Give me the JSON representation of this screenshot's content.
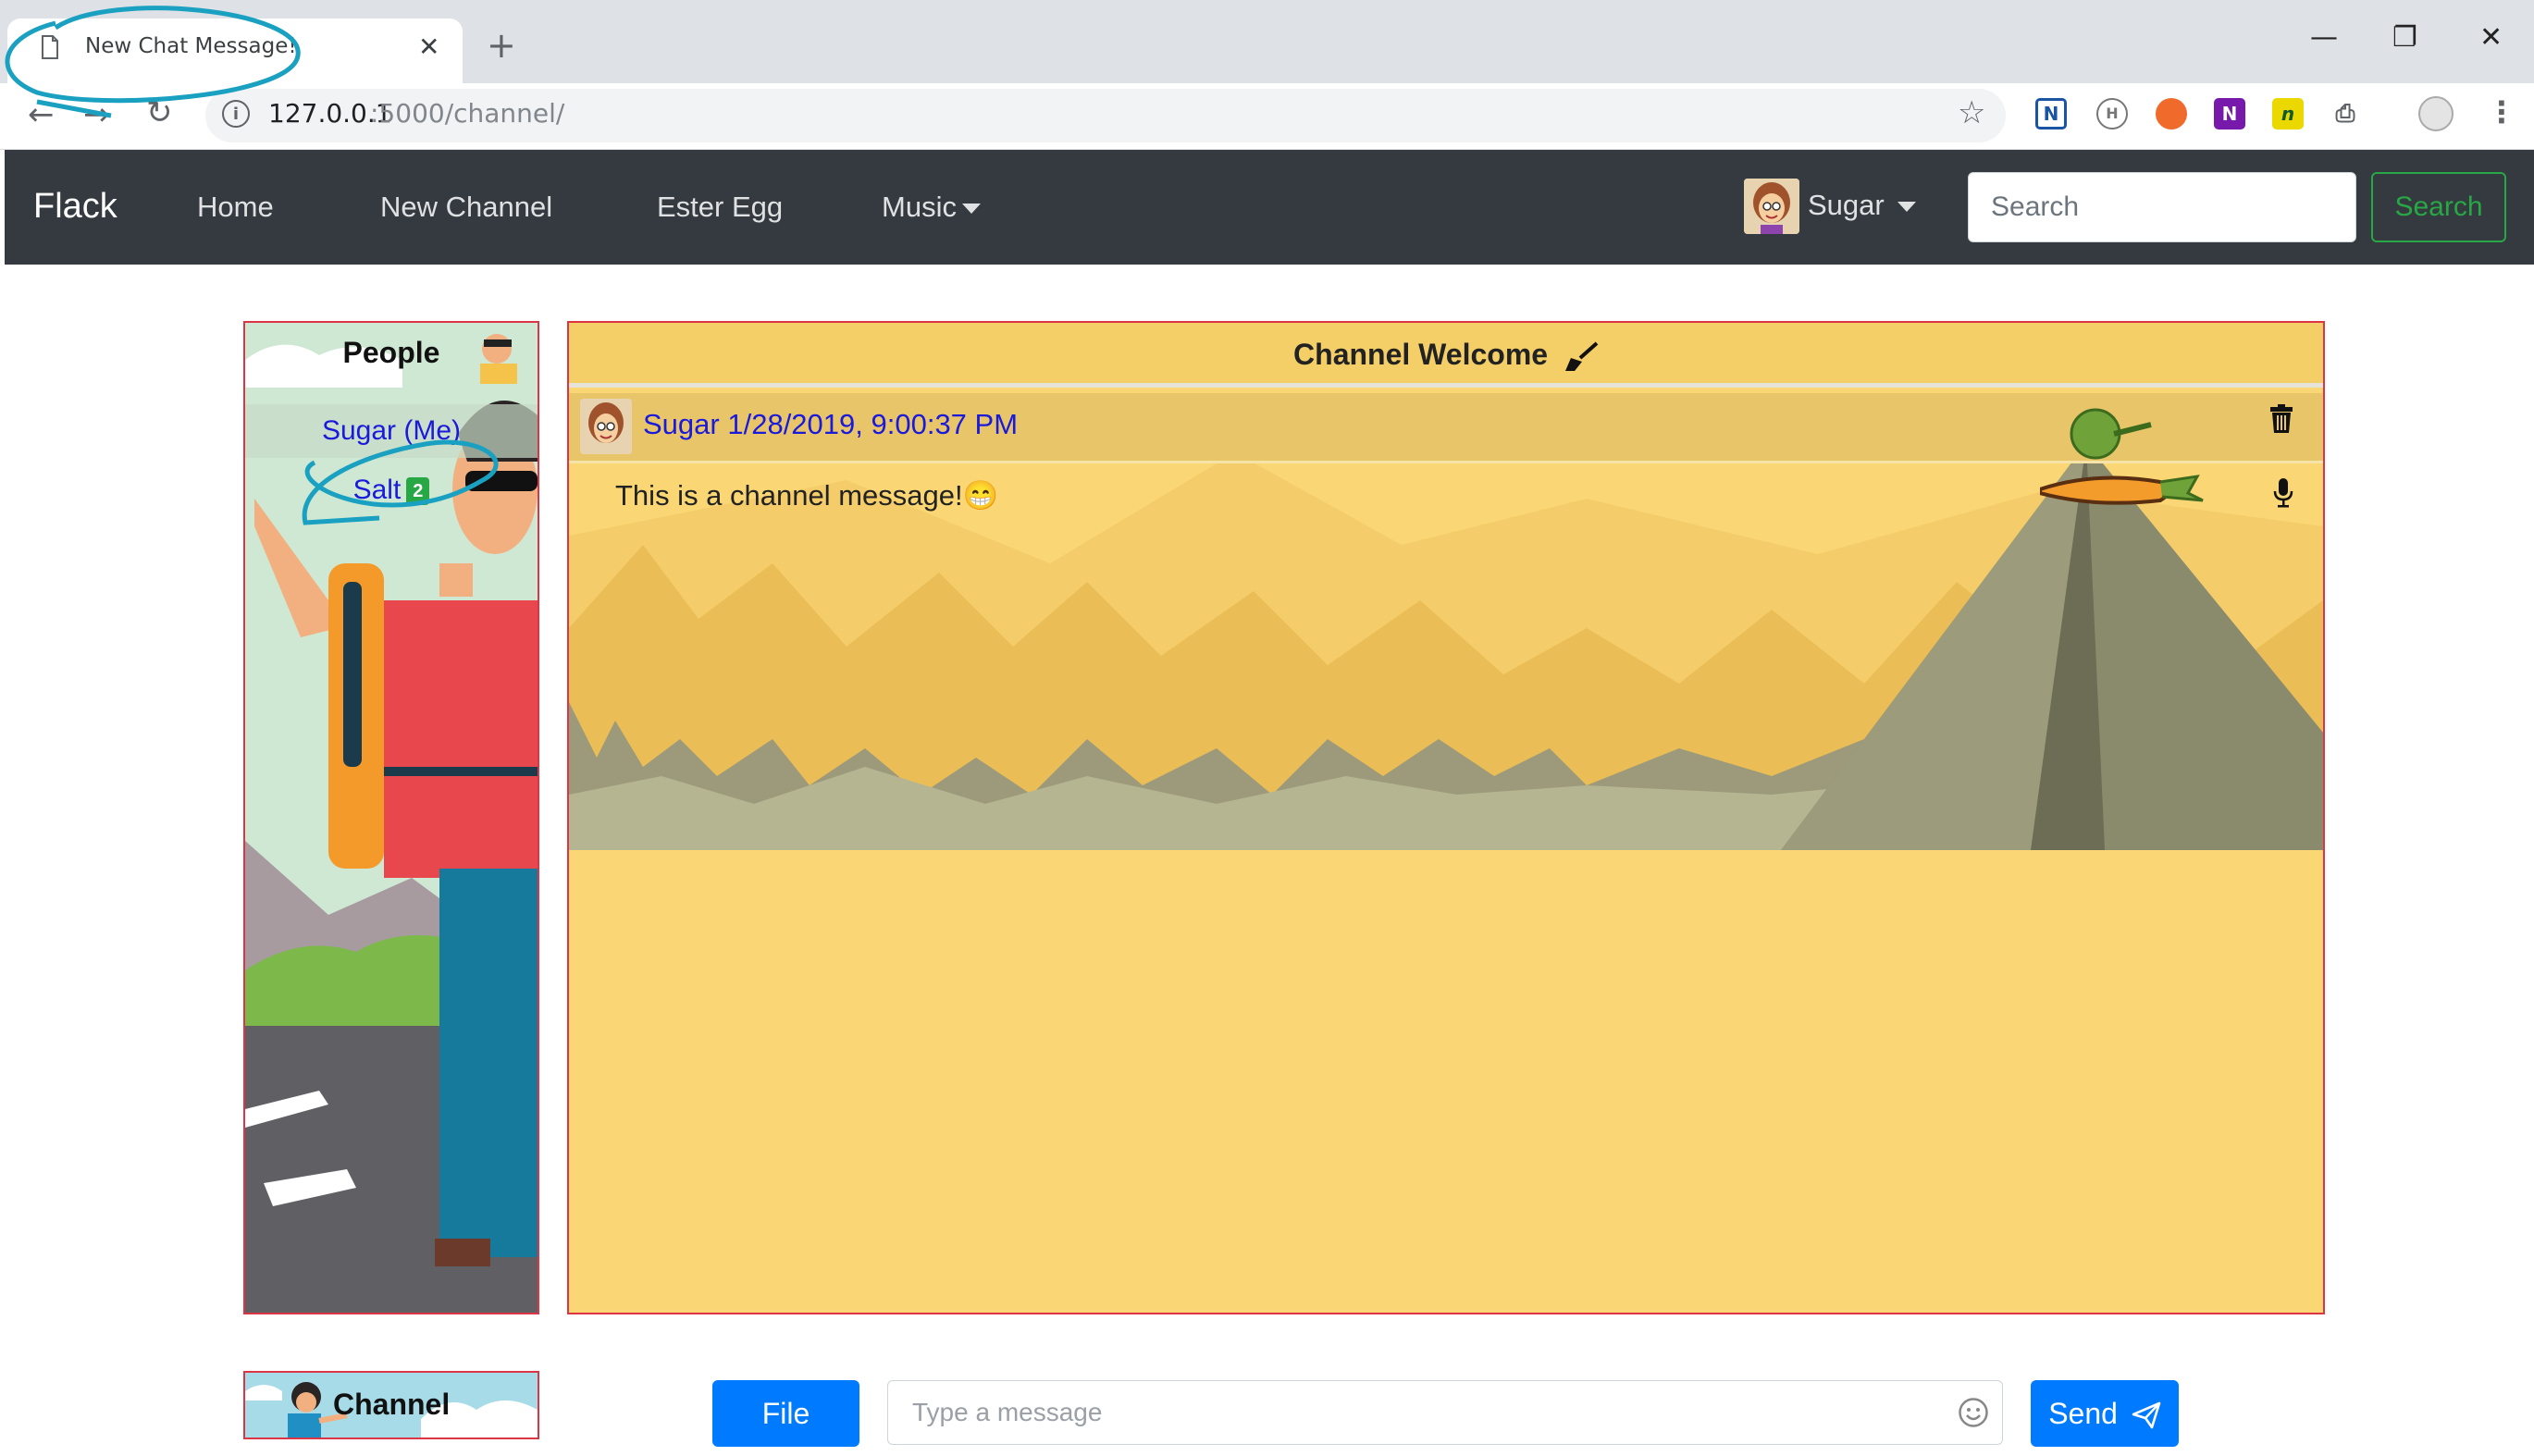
{
  "browser": {
    "tab_title": "New Chat Message!",
    "tab_close": "✕",
    "new_tab": "+",
    "window_controls": {
      "minimize": "—",
      "maximize": "❐",
      "close": "✕"
    },
    "nav": {
      "back": "←",
      "forward": "→",
      "reload": "↻"
    },
    "url_host": "127.0.0.1",
    "url_path": ":5000/channel/",
    "star": "☆",
    "menu": "⋮",
    "extensions": [
      {
        "name": "n-extension-icon",
        "glyph": "N"
      },
      {
        "name": "h-extension-icon",
        "glyph": "H"
      },
      {
        "name": "orange-extension-icon",
        "glyph": ""
      },
      {
        "name": "onenote-icon",
        "glyph": "N"
      },
      {
        "name": "n-yellow-extension-icon",
        "glyph": "n"
      },
      {
        "name": "print-icon",
        "glyph": "⎙"
      }
    ]
  },
  "navbar": {
    "brand": "Flack",
    "links": [
      "Home",
      "New Channel",
      "Ester Egg",
      "Music"
    ],
    "user": "Sugar",
    "search_placeholder": "Search",
    "search_button": "Search"
  },
  "people": {
    "title": "People",
    "list": [
      {
        "name": "Sugar (Me)"
      },
      {
        "name": "Salt",
        "badge": "2"
      }
    ]
  },
  "channel": {
    "title": "Channel Welcome",
    "title_icon": "broom-icon",
    "messages": [
      {
        "author": "Sugar",
        "timestamp": "1/28/2019, 9:00:37 PM",
        "text": "This is a channel message!",
        "emoji": "😁"
      }
    ]
  },
  "footer": {
    "channel_label": "Channel",
    "file_button": "File",
    "message_placeholder": "Type a message",
    "send_button": "Send"
  },
  "colors": {
    "navbar_bg": "#343a40",
    "panel_border": "#dc3545",
    "channel_bg": "#fad774",
    "primary": "#007bff",
    "success": "#28a745",
    "link": "#1a1adb",
    "annotation": "#1aa0c0"
  }
}
